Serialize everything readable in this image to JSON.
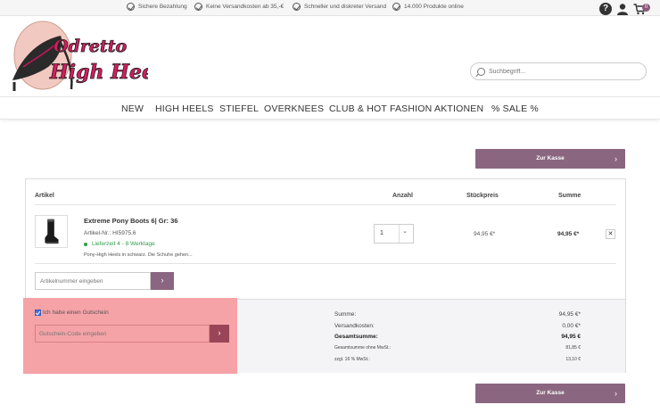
{
  "topbar": {
    "usps": [
      "Sichere Bezahlung",
      "Keine Versandkosten ab 35,-€",
      "Schneller und diskreter Versand",
      "14.000 Produkte online"
    ],
    "cart_count": "0"
  },
  "logo": {
    "line1": "Odretto",
    "line2": "High Heels"
  },
  "search": {
    "placeholder": "Suchbegriff..."
  },
  "nav": [
    "NEW",
    "HIGH HEELS",
    "STIEFEL",
    "OVERKNEES",
    "CLUB & HOT FASHION",
    "AKTIONEN",
    "% SALE %"
  ],
  "checkout_button": "Zur Kasse",
  "cart": {
    "headers": {
      "article": "Artikel",
      "quantity": "Anzahl",
      "unit_price": "Stückpreis",
      "total": "Summe"
    },
    "item": {
      "name": "Extreme Pony Boots 6| Gr: 36",
      "number": "Artikel-Nr.: HI5975.6",
      "delivery": "Lieferzeit 4 - 8 Werktage",
      "description": "Pony-High Heels in schwarz. Die Schuhe gehen...",
      "quantity": "1",
      "unit_price": "94,95 €*",
      "total": "94,95 €*",
      "remove": "✕"
    },
    "article_number_placeholder": "Artikelnummer eingeben"
  },
  "voucher": {
    "checkbox_label": "Ich habe einen Gutschein",
    "checked": true,
    "input_placeholder": "Gutschein-Code eingeben"
  },
  "summary": {
    "sum_label": "Summe:",
    "sum_value": "94,95 €*",
    "shipping_label": "Versandkosten:",
    "shipping_value": "0,00 €*",
    "total_label": "Gesamtsumme:",
    "total_value": "94,95 €",
    "net_label": "Gesamtsumme ohne MwSt.:",
    "net_value": "81,85 €",
    "vat_label": "zzgl. 16 % MwSt.:",
    "vat_value": "13,10 €"
  },
  "colors": {
    "accent": "#8b6680",
    "voucher_bg": "#f5a3a7",
    "in_stock": "#2ea04a"
  }
}
